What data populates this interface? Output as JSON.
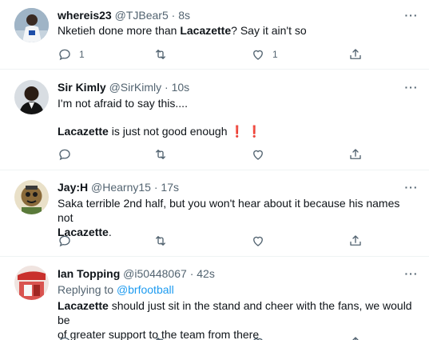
{
  "tweets": [
    {
      "name": "whereis23",
      "handle": "@TJBear5",
      "sep": "·",
      "time": "8s",
      "line1_a": "Nketieh done more than ",
      "line1_b": "Lacazette",
      "line1_c": "? Say it ain't so",
      "reply_count": "1",
      "retweet_count": "",
      "like_count": "1"
    },
    {
      "name": "Sir Kimly",
      "handle": "@SirKimly",
      "sep": "·",
      "time": "10s",
      "line1": "I'm not afraid to say this....",
      "line2_bold": "Lacazette",
      "line2_rest": " is just not good enough ",
      "emoji": "❗ ❗",
      "reply_count": "",
      "retweet_count": "",
      "like_count": ""
    },
    {
      "name": "Jay:H",
      "handle": "@Hearny15",
      "sep": "·",
      "time": "17s",
      "line1": "Saka terrible 2nd half, but you won't hear about it because his names not",
      "line2_bold": "Lacazette",
      "line2_rest": ".",
      "reply_count": "",
      "retweet_count": "",
      "like_count": ""
    },
    {
      "name": "Ian Topping",
      "handle": "@i50448067",
      "sep": "·",
      "time": "42s",
      "replying_label": "Replying to ",
      "replying_handle": "@brfootball",
      "line1_bold": "Lacazette",
      "line1_rest": " should just sit in the stand and cheer with the fans, we would be",
      "line2": "of greater support to the team from there"
    }
  ],
  "icons": {
    "reply": "reply-icon",
    "retweet": "retweet-icon",
    "like": "heart-icon",
    "share": "share-icon",
    "more": "more-options-icon"
  },
  "colors": {
    "text": "#0f1419",
    "muted": "#536471",
    "link": "#1d9bf0",
    "divider": "#eff3f4"
  }
}
